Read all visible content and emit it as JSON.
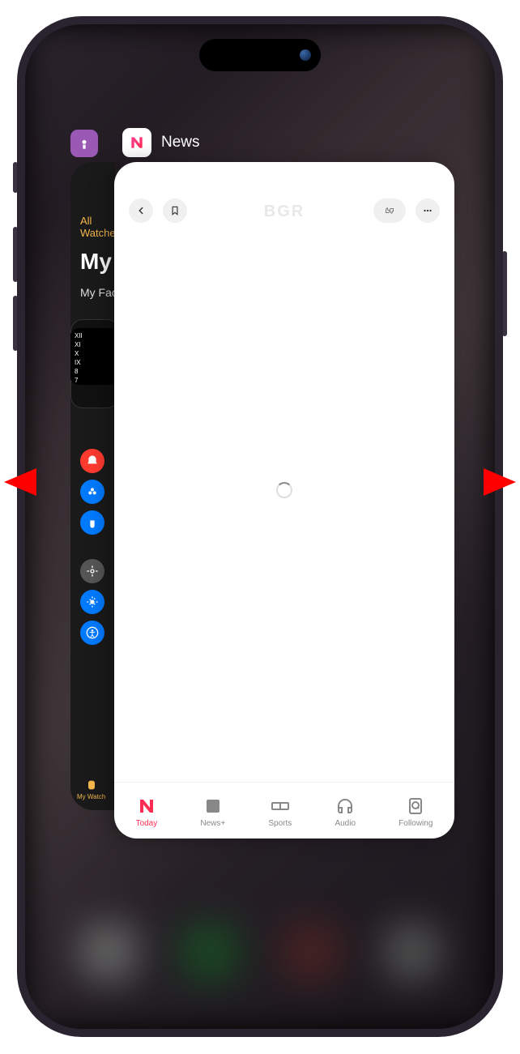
{
  "front_app": {
    "name": "News",
    "header_title": "BGR",
    "tabbar": [
      {
        "label": "Today",
        "active": true
      },
      {
        "label": "News+",
        "active": false
      },
      {
        "label": "Sports",
        "active": false
      },
      {
        "label": "Audio",
        "active": false
      },
      {
        "label": "Following",
        "active": false
      }
    ]
  },
  "back_app": {
    "top_tab": "All Watches",
    "title": "My Apple Watch",
    "subtitle": "My Faces",
    "watch_numerals": "XII\nXI\nX\nIX\n8\n7",
    "bottom_tab": "My Watch"
  }
}
